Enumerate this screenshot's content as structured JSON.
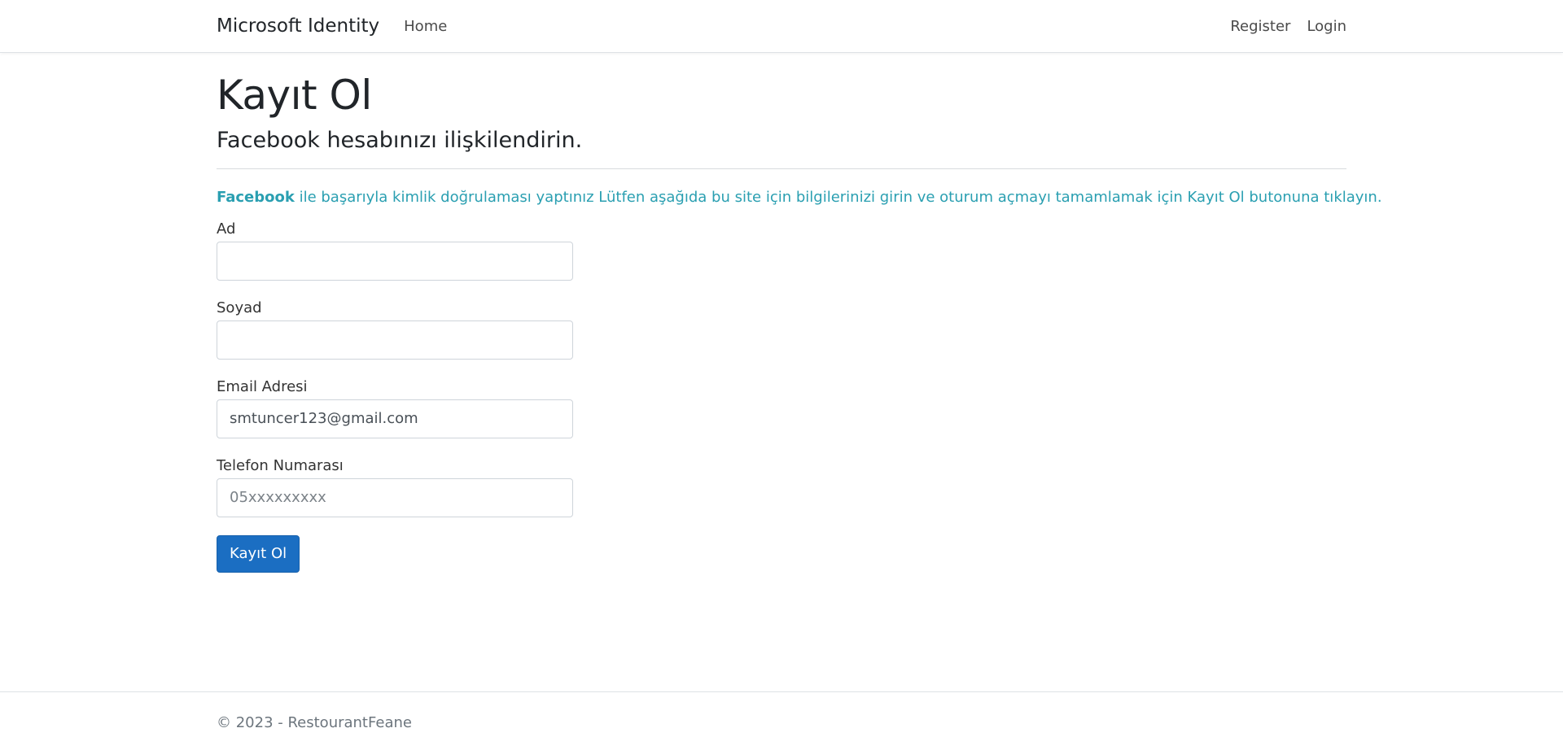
{
  "navbar": {
    "brand": "Microsoft Identity",
    "home": "Home",
    "register": "Register",
    "login": "Login"
  },
  "page": {
    "title": "Kayıt Ol",
    "subtitle": "Facebook hesabınızı ilişkilendirin.",
    "info_provider": "Facebook",
    "info_text": " ile başarıyla kimlik doğrulaması yaptınız Lütfen aşağıda bu site için bilgilerinizi girin ve oturum açmayı tamamlamak için Kayıt Ol butonuna tıklayın."
  },
  "form": {
    "first_name_label": "Ad",
    "first_name_value": "",
    "last_name_label": "Soyad",
    "last_name_value": "",
    "email_label": "Email Adresi",
    "email_value": "smtuncer123@gmail.com",
    "phone_label": "Telefon Numarası",
    "phone_placeholder": "05xxxxxxxxx",
    "submit_label": "Kayıt Ol"
  },
  "footer": {
    "text": "© 2023 - RestourantFeane"
  },
  "colors": {
    "primary": "#1b6ec2",
    "info": "#2a9fb1"
  }
}
